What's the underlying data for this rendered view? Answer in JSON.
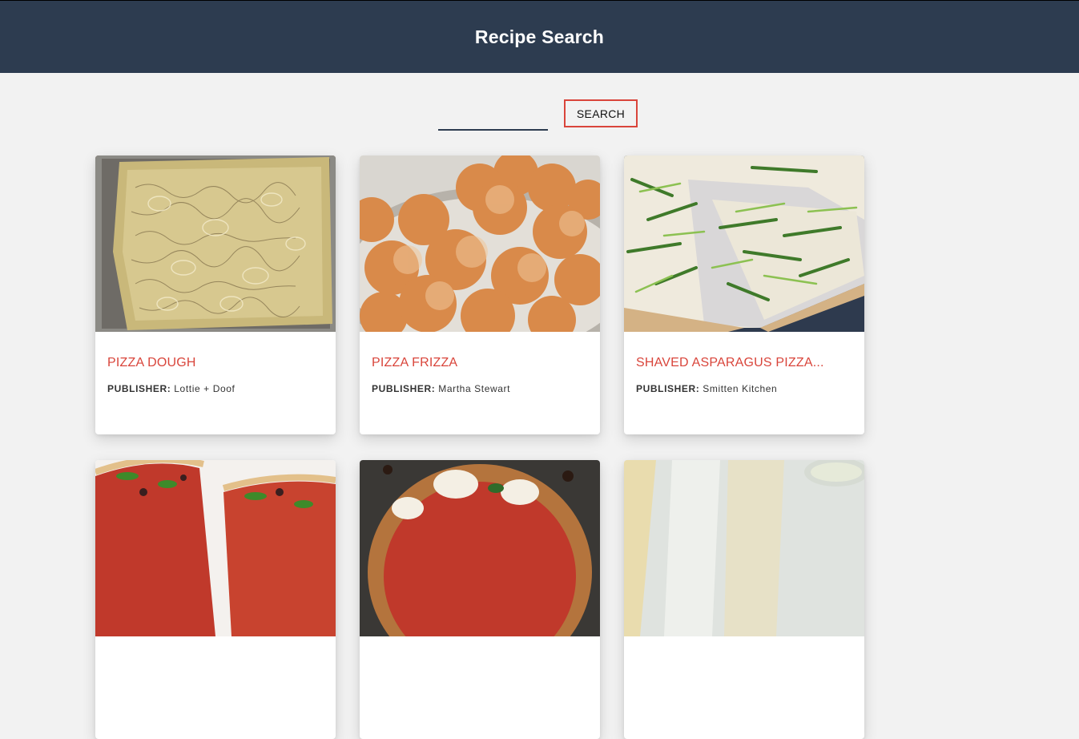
{
  "header": {
    "title": "Recipe Search"
  },
  "search": {
    "placeholder": "",
    "value": "",
    "button_label": "SEARCH"
  },
  "publisher_label": "PUBLISHER:",
  "recipes": [
    {
      "title": "PIZZA DOUGH",
      "publisher": "Lottie + Doof",
      "image": "onion-flatbread-photo"
    },
    {
      "title": "PIZZA FRIZZA",
      "publisher": "Martha Stewart",
      "image": "sugared-dough-balls-photo"
    },
    {
      "title": "SHAVED ASPARAGUS PIZZA...",
      "publisher": "Smitten Kitchen",
      "image": "asparagus-pizza-photo"
    },
    {
      "title": "",
      "publisher": "",
      "image": "arugula-pizza-photo"
    },
    {
      "title": "",
      "publisher": "",
      "image": "margherita-pizza-photo"
    },
    {
      "title": "",
      "publisher": "",
      "image": "drink-photo"
    }
  ],
  "colors": {
    "header_bg": "#2d3c50",
    "accent": "#d9453b",
    "page_bg": "#f2f2f2"
  }
}
